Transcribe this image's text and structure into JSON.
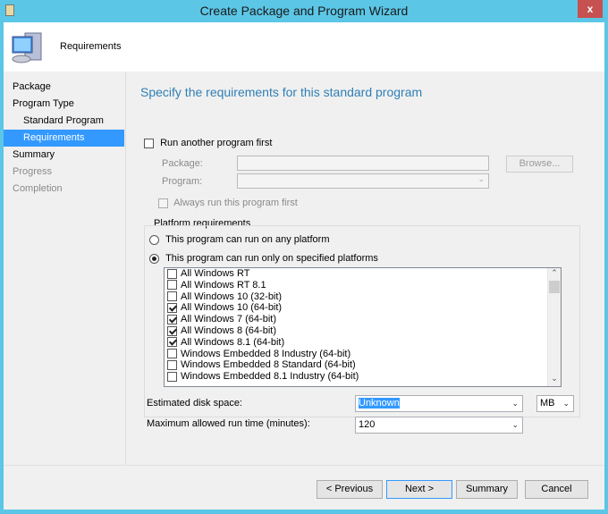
{
  "window": {
    "title": "Create Package and Program Wizard",
    "close_label": "x"
  },
  "header": {
    "title": "Requirements"
  },
  "sidebar": {
    "items": [
      {
        "label": "Package",
        "state": "normal"
      },
      {
        "label": "Program Type",
        "state": "normal"
      },
      {
        "label": "Standard Program",
        "state": "normal"
      },
      {
        "label": "Requirements",
        "state": "selected"
      },
      {
        "label": "Summary",
        "state": "normal"
      },
      {
        "label": "Progress",
        "state": "disabled"
      },
      {
        "label": "Completion",
        "state": "disabled"
      }
    ]
  },
  "main": {
    "title": "Specify the requirements for this standard program",
    "run_another": {
      "label": "Run another program first",
      "checked": false
    },
    "package_label": "Package:",
    "package_value": "",
    "browse_label": "Browse...",
    "program_label": "Program:",
    "program_value": "",
    "always_run": {
      "label": "Always run this program first",
      "checked": false
    },
    "platform": {
      "legend": "Platform requirements",
      "any_label": "This program can run on any platform",
      "specified_label": "This program can run only on specified platforms",
      "selected": "specified",
      "items": [
        {
          "label": "All Windows RT",
          "checked": false
        },
        {
          "label": "All Windows RT 8.1",
          "checked": false
        },
        {
          "label": "All Windows 10 (32-bit)",
          "checked": false
        },
        {
          "label": "All Windows 10 (64-bit)",
          "checked": true
        },
        {
          "label": "All Windows 7 (64-bit)",
          "checked": true
        },
        {
          "label": "All Windows 8 (64-bit)",
          "checked": true
        },
        {
          "label": "All Windows 8.1 (64-bit)",
          "checked": true
        },
        {
          "label": "Windows Embedded 8 Industry (64-bit)",
          "checked": false
        },
        {
          "label": "Windows Embedded 8 Standard (64-bit)",
          "checked": false
        },
        {
          "label": "Windows Embedded 8.1 Industry (64-bit)",
          "checked": false
        }
      ]
    },
    "disk_label": "Estimated disk space:",
    "disk_value": "Unknown",
    "disk_unit": "MB",
    "runtime_label": "Maximum allowed run time (minutes):",
    "runtime_value": "120"
  },
  "footer": {
    "previous": "< Previous",
    "next": "Next >",
    "summary": "Summary",
    "cancel": "Cancel"
  }
}
